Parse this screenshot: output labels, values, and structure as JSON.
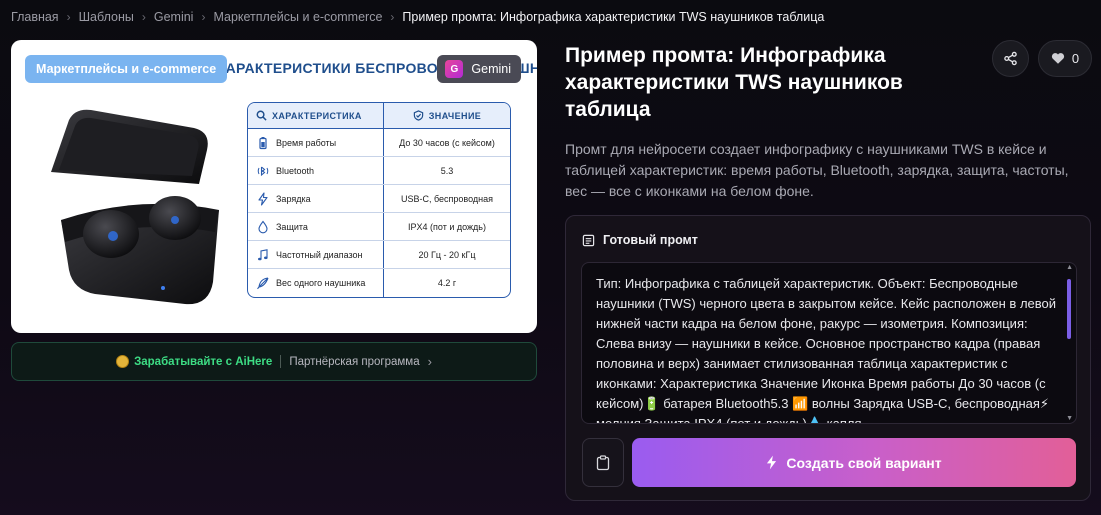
{
  "breadcrumb": {
    "items": [
      "Главная",
      "Шаблоны",
      "Gemini",
      "Маркетплейсы и e-commerce"
    ],
    "current": "Пример промта: Инфографика характеристики TWS наушников таблица",
    "separator": "›"
  },
  "preview": {
    "category_badge": "Маркетплейсы и e-commerce",
    "model_badge": "Gemini",
    "model_icon_letter": "G",
    "infographic_title": "ХАРАКТЕРИСТИКИ БЕСПРОВОДНЫХ НАУШНИ",
    "table": {
      "head_left": "ХАРАКТЕРИСТИКА",
      "head_right": "ЗНАЧЕНИЕ",
      "rows": [
        {
          "label": "Время работы",
          "value": "До 30 часов (с кейсом)",
          "icon": "battery-icon"
        },
        {
          "label": "Bluetooth",
          "value": "5.3",
          "icon": "bluetooth-waves-icon"
        },
        {
          "label": "Зарядка",
          "value": "USB-C, беспроводная",
          "icon": "lightning-icon"
        },
        {
          "label": "Защита",
          "value": "IPX4 (пот и дождь)",
          "icon": "water-drop-icon"
        },
        {
          "label": "Частотный диапазон",
          "value": "20 Гц - 20 кГц",
          "icon": "music-note-icon"
        },
        {
          "label": "Вес одного наушника",
          "value": "4.2 г",
          "icon": "feather-icon"
        }
      ]
    }
  },
  "partner": {
    "earn": "Зарабатывайте с AiHere",
    "program": "Партнёрская программа",
    "chevron": "›"
  },
  "header": {
    "title": "Пример промта: Инфографика характеристики TWS наушников таблица",
    "like_count": "0"
  },
  "description": "Промт для нейросети создает инфографику с наушниками TWS в кейсе и таблицей характеристик: время работы, Bluetooth, зарядка, защита, частоты, вес — все с иконками на белом фоне.",
  "prompt": {
    "heading": "Готовый промт",
    "text": "Тип: Инфографика с таблицей характеристик. Объект: Беспроводные наушники (TWS) черного цвета в закрытом кейсе. Кейс расположен в левой нижней части кадра на белом фоне, ракурс — изометрия. Композиция: Слева внизу — наушники в кейсе. Основное пространство кадра (правая половина и верх) занимает стилизованная таблица характеристик с иконками: Характеристика Значение Иконка Время работы До 30 часов (с кейсом)🔋 батарея Bluetooth5.3 📶 волны Зарядка USB-C, беспроводная⚡ молния Защита IPX4 (пот и дождь)💧 капля",
    "create_label": "Создать свой вариант"
  },
  "colors": {
    "accent_gradient_start": "#9a5cf0",
    "accent_gradient_end": "#e25f98",
    "partner_green": "#3ddc84",
    "category_badge": "#7ab4f0"
  }
}
